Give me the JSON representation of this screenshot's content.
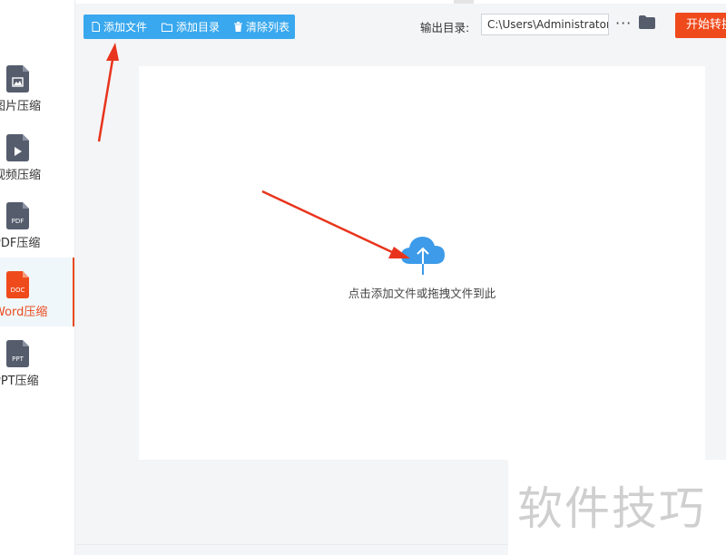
{
  "sidebar": {
    "items": [
      {
        "label": "图片压缩",
        "icon": "image-file-icon",
        "color": "#555d6d",
        "active": false
      },
      {
        "label": "视频压缩",
        "icon": "video-file-icon",
        "color": "#555d6d",
        "active": false
      },
      {
        "label": "PDF压缩",
        "icon": "pdf-file-icon",
        "icon_text": "PDF",
        "color": "#555d6d",
        "active": false
      },
      {
        "label": "Word压缩",
        "icon": "doc-file-icon",
        "icon_text": "DOC",
        "color": "#e94b1d",
        "active": true
      },
      {
        "label": "PPT压缩",
        "icon": "ppt-file-icon",
        "icon_text": "PPT",
        "color": "#555d6d",
        "active": false
      }
    ]
  },
  "toolbar": {
    "add_file": "添加文件",
    "add_folder": "添加目录",
    "clear_list": "清除列表"
  },
  "output": {
    "label": "输出目录:",
    "path": "C:\\Users\\Administrator\\",
    "start_button": "开始转换"
  },
  "drop_area": {
    "hint": "点击添加文件或拖拽文件到此"
  },
  "watermark": "软件技巧",
  "colors": {
    "accent": "#e94b1d",
    "toolbar_blue": "#39a8ee",
    "cloud_blue": "#3d9be9",
    "arrow_red": "#e8341c"
  }
}
